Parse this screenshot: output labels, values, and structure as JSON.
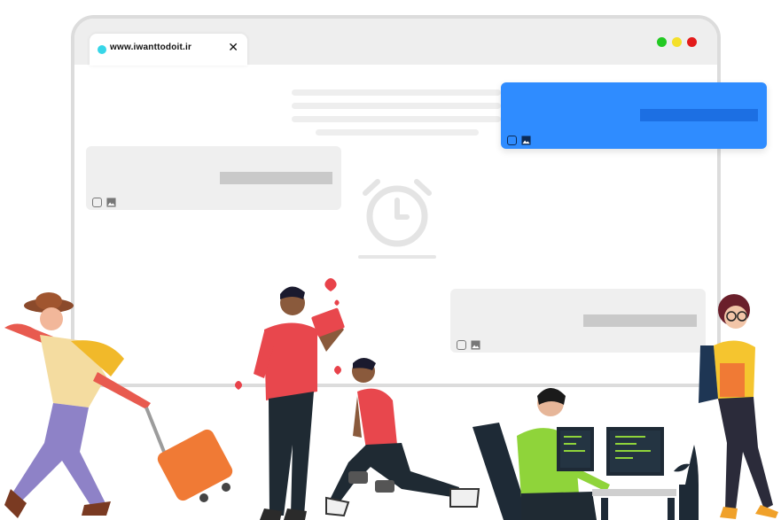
{
  "browser": {
    "tab": {
      "url": "www.iwanttodoit.ir",
      "close_symbol": "✕"
    },
    "window_controls": [
      "green",
      "yellow",
      "red"
    ]
  },
  "colors": {
    "accent_blue": "#2f8cff",
    "favicon": "#37d6e8",
    "card_gray": "#efefef"
  },
  "icons": {
    "alarm": "alarm-clock-icon",
    "image": "image-icon",
    "checkbox": "checkbox-icon"
  }
}
